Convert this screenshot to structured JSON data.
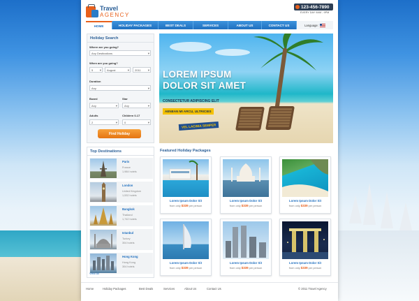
{
  "brand": {
    "name_line1": "Travel",
    "name_line2": "AGENCY"
  },
  "contact": {
    "phone": "123-456-7890",
    "hours": "EVERY DAY 9AM - 9PM"
  },
  "nav": {
    "items": [
      "HOME",
      "HOLIDAY PACKAGES",
      "BEST DEALS",
      "SERVICES",
      "ABOUT US",
      "CONTACT US"
    ],
    "language_label": "Language:"
  },
  "search": {
    "title": "Holiday Search",
    "where_going_label": "Where are you going?",
    "where_going_value": "Any Destinations",
    "when_going_label": "When are you going?",
    "day": "5",
    "month": "August",
    "year": "2011",
    "duration_label": "Duration",
    "duration_value": "Any",
    "board_label": "Board",
    "board_value": "Any",
    "star_label": "Star",
    "star_value": "Any",
    "adults_label": "Adults",
    "adults_value": "2",
    "children_label": "Children 0-17",
    "children_value": "0",
    "button": "Find Holiday"
  },
  "hero": {
    "headline_1": "LOREM IPSUM",
    "headline_2": "DOLOR SIT AMET",
    "subtitle": "CONSECTETUR ADIPISCING ELIT",
    "tag_1": "AENEAN MI ARCU, ULTRICIES",
    "tag_2": "VEL LACINIA SEMPER"
  },
  "destinations": {
    "title": "Top Destinations",
    "items": [
      {
        "city": "Paris",
        "country": "France",
        "hotels": "1,984 hotels"
      },
      {
        "city": "London",
        "country": "United Kingdom",
        "hotels": "1,532 hotels"
      },
      {
        "city": "Bangkok",
        "country": "Thailand",
        "hotels": "1,742 hotels"
      },
      {
        "city": "Istanbul",
        "country": "Turkey",
        "hotels": "304 hotels"
      },
      {
        "city": "Hong Kong",
        "country": "Hong Kong",
        "hotels": "304 hotels"
      }
    ],
    "view_all": "View All"
  },
  "featured": {
    "title": "Featured Holiday Packages",
    "cards": [
      {
        "title": "Lorem Ipsum Dolor Sit",
        "price_prefix": "from only",
        "price": "$339",
        "price_suffix": "per person"
      },
      {
        "title": "Lorem Ipsum Dolor Sit",
        "price_prefix": "from only",
        "price": "$339",
        "price_suffix": "per person"
      },
      {
        "title": "Lorem Ipsum Dolor Sit",
        "price_prefix": "from only",
        "price": "$339",
        "price_suffix": "per person"
      },
      {
        "title": "Lorem Ipsum Dolor Sit",
        "price_prefix": "from only",
        "price": "$339",
        "price_suffix": "per person"
      },
      {
        "title": "Lorem Ipsum Dolor Sit",
        "price_prefix": "from only",
        "price": "$339",
        "price_suffix": "per person"
      },
      {
        "title": "Lorem Ipsum Dolor Sit",
        "price_prefix": "from only",
        "price": "$339",
        "price_suffix": "per person"
      }
    ]
  },
  "footer": {
    "links": [
      "Home",
      "Holiday Packages",
      "Best Deals",
      "Services",
      "About Us",
      "Contact Us"
    ],
    "copyright": "© 2011 Travel Agency"
  },
  "colors": {
    "brand_blue": "#1f6fbf",
    "accent_orange": "#e8601c",
    "dark_navy": "#2d3e54",
    "tag_yellow": "#f5c200"
  },
  "icons": [
    "phone-icon",
    "flag-icon"
  ]
}
